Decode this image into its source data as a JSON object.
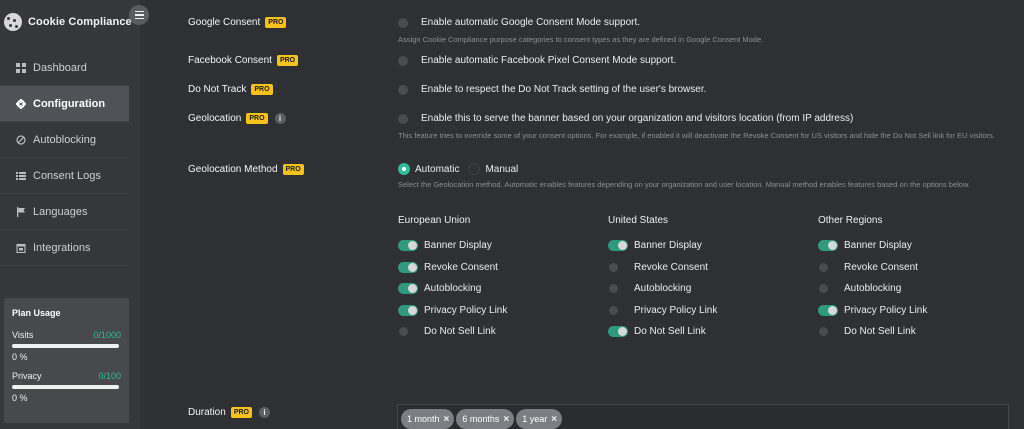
{
  "sidebar": {
    "brand": "Cookie Compliance",
    "items": [
      {
        "label": "Dashboard",
        "icon": "grid-icon"
      },
      {
        "label": "Configuration",
        "icon": "gear-icon",
        "active": true
      },
      {
        "label": "Autoblocking",
        "icon": "block-icon"
      },
      {
        "label": "Consent Logs",
        "icon": "list-icon"
      },
      {
        "label": "Languages",
        "icon": "flag-icon"
      },
      {
        "label": "Integrations",
        "icon": "calendar-icon"
      }
    ],
    "plan": {
      "title": "Plan Usage",
      "visits_label": "Visits",
      "visits_count": "0/1000",
      "visits_pct": "0 %",
      "visits_fraction": 0,
      "privacy_label": "Privacy",
      "privacy_count": "0/100",
      "privacy_pct": "0 %",
      "privacy_fraction": 0
    }
  },
  "pro_badge": "PRO",
  "info_glyph": "i",
  "settings": {
    "google": {
      "label": "Google Consent",
      "text": "Enable automatic Google Consent Mode support.",
      "desc": "Assign Cookie Compliance purpose categories to consent types as they are defined in Google Consent Mode."
    },
    "facebook": {
      "label": "Facebook Consent",
      "text": "Enable automatic Facebook Pixel Consent Mode support."
    },
    "dnt": {
      "label": "Do Not Track",
      "text": "Enable to respect the Do Not Track setting of the user's browser."
    },
    "geo": {
      "label": "Geolocation",
      "text": "Enable this to serve the banner based on your organization and visitors location (from IP address)",
      "desc": "This feature tries to override some of your consent options. For example, if enabled it will deactivate the Revoke Consent for US visitors and hide the Do Not Sell link for EU visitors."
    },
    "geo_method": {
      "label": "Geolocation Method",
      "option_auto": "Automatic",
      "option_manual": "Manual",
      "selected": "Automatic",
      "desc": "Select the Geolocation method. Automatic enables features depending on your organization and user location. Manual method enables features based on the options below."
    },
    "duration": {
      "label": "Duration",
      "tags": [
        "1 month",
        "6 months",
        "1 year"
      ]
    }
  },
  "regions": [
    {
      "name": "European Union",
      "options": [
        {
          "label": "Banner Display",
          "on": true
        },
        {
          "label": "Revoke Consent",
          "on": true
        },
        {
          "label": "Autoblocking",
          "on": true
        },
        {
          "label": "Privacy Policy Link",
          "on": true
        },
        {
          "label": "Do Not Sell Link",
          "on": false
        }
      ]
    },
    {
      "name": "United States",
      "options": [
        {
          "label": "Banner Display",
          "on": true
        },
        {
          "label": "Revoke Consent",
          "on": false
        },
        {
          "label": "Autoblocking",
          "on": false
        },
        {
          "label": "Privacy Policy Link",
          "on": false
        },
        {
          "label": "Do Not Sell Link",
          "on": true
        }
      ]
    },
    {
      "name": "Other Regions",
      "options": [
        {
          "label": "Banner Display",
          "on": true
        },
        {
          "label": "Revoke Consent",
          "on": false
        },
        {
          "label": "Autoblocking",
          "on": false
        },
        {
          "label": "Privacy Policy Link",
          "on": true
        },
        {
          "label": "Do Not Sell Link",
          "on": false
        }
      ]
    }
  ],
  "colors": {
    "accent": "#2dbd9a",
    "pro_badge": "#f6c21b",
    "background": "#2f3135"
  }
}
